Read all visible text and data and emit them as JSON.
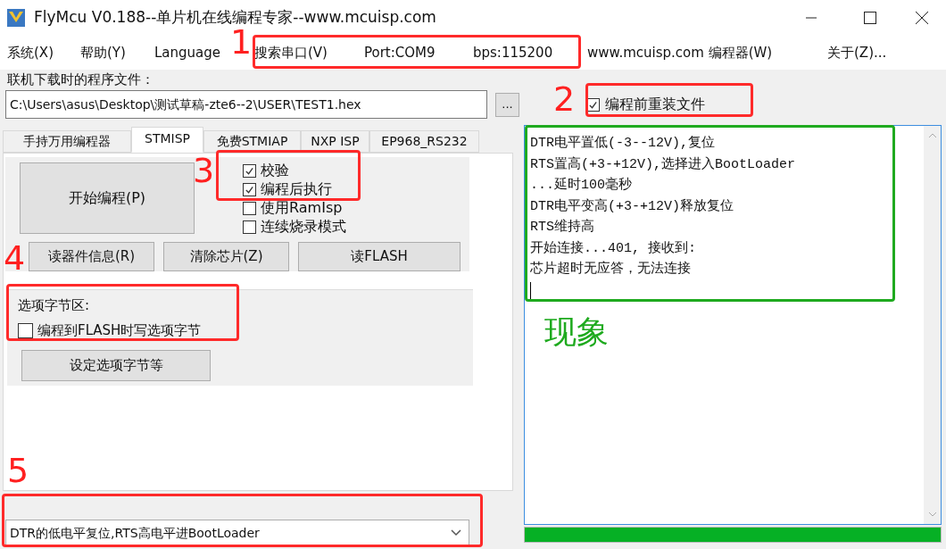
{
  "window": {
    "title": "FlyMcu V0.188--单片机在线编程专家--www.mcuisp.com"
  },
  "menu": [
    "系统(X)",
    "帮助(Y)",
    "Language",
    "搜索串口(V)",
    "Port:COM9",
    "bps:115200",
    "www.mcuisp.com 编程器(W)",
    "关于(Z)..."
  ],
  "file": {
    "label": "联机下载时的程序文件：",
    "path": "C:\\Users\\asus\\Desktop\\测试草稿-zte6--2\\USER\\TEST1.hex",
    "browse": "...",
    "reload": {
      "label": "编程前重装文件",
      "checked": true
    }
  },
  "tabs": [
    {
      "label": "手持万用编程器",
      "selected": false
    },
    {
      "label": "STMISP",
      "selected": true
    },
    {
      "label": "免费STMIAP",
      "selected": false
    },
    {
      "label": "NXP ISP",
      "selected": false
    },
    {
      "label": "EP968_RS232",
      "selected": false
    }
  ],
  "start_button": "开始编程(P)",
  "options": [
    {
      "label": "校验",
      "checked": true
    },
    {
      "label": "编程后执行",
      "checked": true
    },
    {
      "label": "使用RamIsp",
      "checked": false
    },
    {
      "label": "连续烧录模式",
      "checked": false
    }
  ],
  "buttons": [
    "读器件信息(R)",
    "清除芯片(Z)",
    "读FLASH"
  ],
  "option_bytes": {
    "title": "选项字节区:",
    "checkbox": {
      "label": "编程到FLASH时写选项字节",
      "checked": false
    },
    "button": "设定选项字节等"
  },
  "reset_mode": {
    "value": "DTR的低电平复位,RTS高电平进BootLoader"
  },
  "log": [
    "DTR电平置低(-3--12V),复位",
    "RTS置高(+3-+12V),选择进入BootLoader",
    "...延时100毫秒",
    "DTR电平变高(+3-+12V)释放复位",
    "RTS维持高",
    "开始连接...401, 接收到:",
    "芯片超时无应答，无法连接"
  ],
  "progress": {
    "level": 1
  },
  "annotations": [
    {
      "label": "1"
    },
    {
      "label": "2"
    },
    {
      "label": "3"
    },
    {
      "label": "4"
    },
    {
      "label": "5"
    }
  ],
  "observation": {
    "label": "现象"
  }
}
